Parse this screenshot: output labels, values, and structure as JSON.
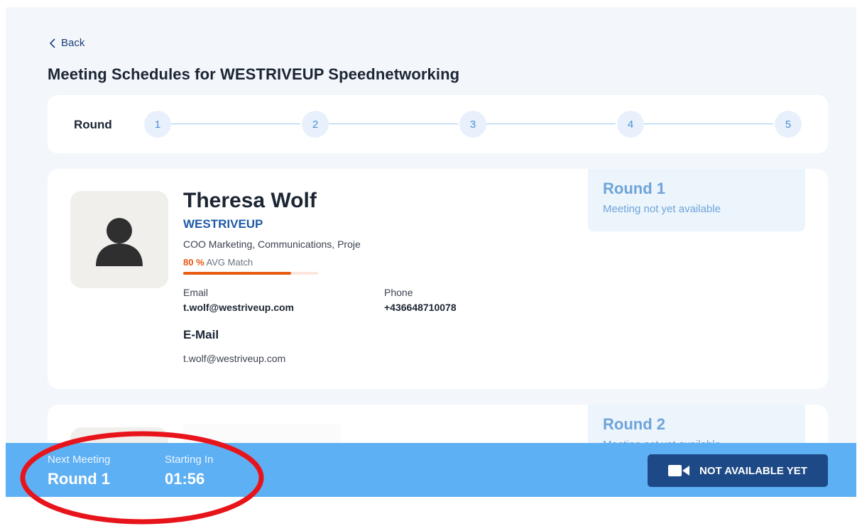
{
  "nav": {
    "back_label": "Back"
  },
  "page_title": "Meeting Schedules for WESTRIVEUP Speednetworking",
  "rounds_bar": {
    "label": "Round",
    "rounds": [
      "1",
      "2",
      "3",
      "4",
      "5"
    ]
  },
  "meetings": [
    {
      "name": "Theresa Wolf",
      "company": "WESTRIVEUP",
      "role": "COO Marketing, Communications, Proje",
      "match_percent": "80 %",
      "match_label": "AVG Match",
      "match_fraction": 0.8,
      "email_label": "Email",
      "email": "t.wolf@westriveup.com",
      "phone_label": "Phone",
      "phone": "+436648710078",
      "email_heading": "E-Mail",
      "email_value": "t.wolf@westriveup.com",
      "round_title": "Round 1",
      "round_status": "Meeting not yet available"
    },
    {
      "round_title": "Round 2",
      "round_status": "Meeting not yet available"
    }
  ],
  "bottom_bar": {
    "next_meeting_label": "Next Meeting",
    "next_meeting_value": "Round 1",
    "starting_in_label": "Starting In",
    "starting_in_value": "01:56",
    "button_label": "NOT AVAILABLE YET"
  },
  "colors": {
    "accent": "#1f5aa6",
    "bottom_bar": "#5eb0f4",
    "button": "#1d4a86",
    "match_bar": "#ea5b12",
    "annotation": "#e8141b"
  },
  "icons": [
    "chevron-left-icon",
    "user-icon",
    "video-camera-icon"
  ]
}
